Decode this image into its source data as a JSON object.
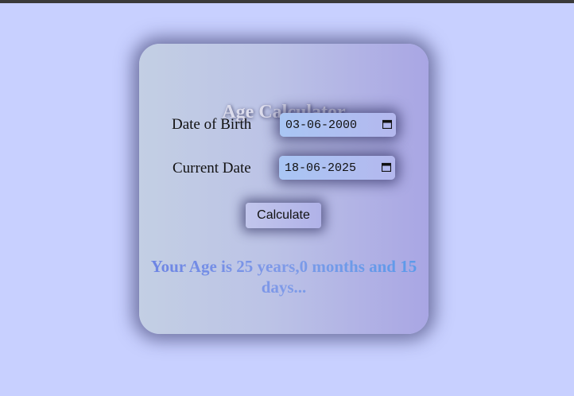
{
  "title": "Age Calculator",
  "dob": {
    "label": "Date of Birth",
    "value": "03-06-2000"
  },
  "current": {
    "label": "Current Date",
    "value": "18-06-2025"
  },
  "calculate_label": "Calculate",
  "result": "Your Age is 25 years,0 months and 15 days...",
  "icons": {
    "calendar": "calendar-icon"
  },
  "colors": {
    "page_background": "#c8d0ff",
    "result_text": "#6c84e4"
  }
}
